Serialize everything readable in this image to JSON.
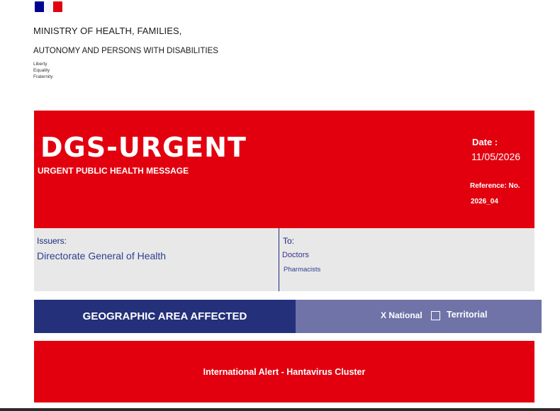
{
  "header": {
    "ministry_line1": "MINISTRY OF HEALTH, FAMILIES,",
    "ministry_line2": "AUTONOMY AND PERSONS WITH DISABILITIES",
    "motto": [
      "Liberty",
      "Equality",
      "Fraternity"
    ]
  },
  "banner": {
    "title": "DGS-URGENT",
    "subtitle": "URGENT PUBLIC HEALTH MESSAGE",
    "date_label": "Date :",
    "date_value": "11/05/2026",
    "reference_label": "Reference: No.",
    "reference_value": "2026_04"
  },
  "info": {
    "issuers_label": "Issuers:",
    "issuers_value": "Directorate General of Health",
    "to_label": "To:",
    "recipients": [
      "Doctors",
      "Pharmacists"
    ]
  },
  "geo": {
    "title": "GEOGRAPHIC AREA AFFECTED",
    "option_national": "X National",
    "option_territorial": "Territorial"
  },
  "alert": {
    "text": "International Alert - Hantavirus Cluster"
  },
  "colors": {
    "alert_red": "#e2000f",
    "navy": "#24307a",
    "lavender": "#6f73a8",
    "panel_gray": "#e8e8e8"
  }
}
